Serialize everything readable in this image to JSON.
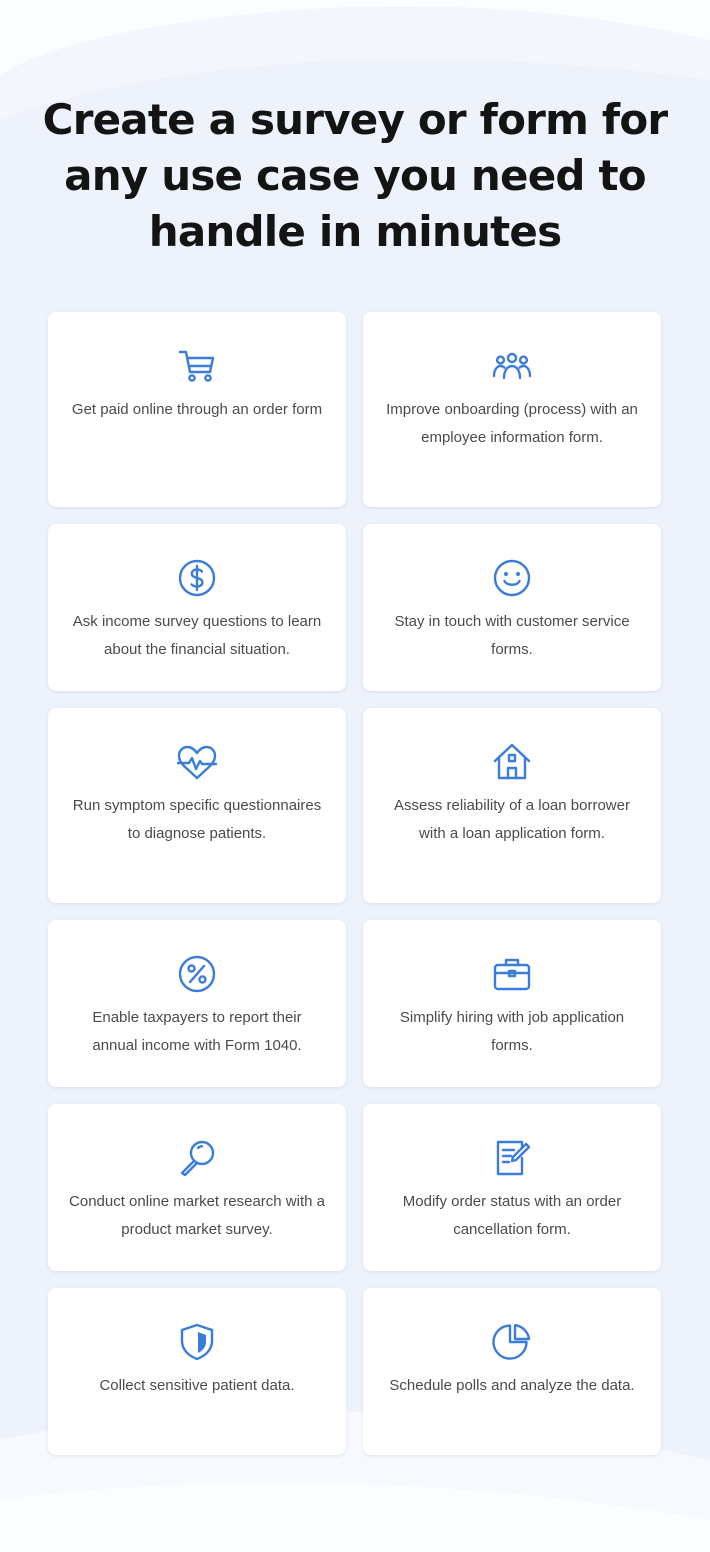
{
  "headline": "Create a survey or form for any use case you need to handle in minutes",
  "accent_color": "#3b7dd8",
  "cards": [
    {
      "icon": "shopping-cart-icon",
      "text": "Get paid online through an order form"
    },
    {
      "icon": "team-icon",
      "text": "Improve onboarding (process) with an employee information form."
    },
    {
      "icon": "dollar-circle-icon",
      "text": "Ask income survey questions to learn about the financial situation."
    },
    {
      "icon": "smiley-face-icon",
      "text": "Stay in touch with customer service forms."
    },
    {
      "icon": "heartbeat-icon",
      "text": "Run symptom specific questionnaires to diagnose patients."
    },
    {
      "icon": "house-icon",
      "text": "Assess reliability of a loan borrower with a loan application form."
    },
    {
      "icon": "percent-circle-icon",
      "text": "Enable taxpayers to report their annual income with Form 1040."
    },
    {
      "icon": "briefcase-icon",
      "text": "Simplify hiring with job application forms."
    },
    {
      "icon": "magnifier-icon",
      "text": "Conduct online market research with a product market survey."
    },
    {
      "icon": "edit-document-icon",
      "text": "Modify order status with an order cancellation form."
    },
    {
      "icon": "shield-icon",
      "text": "Collect sensitive patient data."
    },
    {
      "icon": "pie-chart-icon",
      "text": "Schedule polls and analyze the data."
    }
  ]
}
